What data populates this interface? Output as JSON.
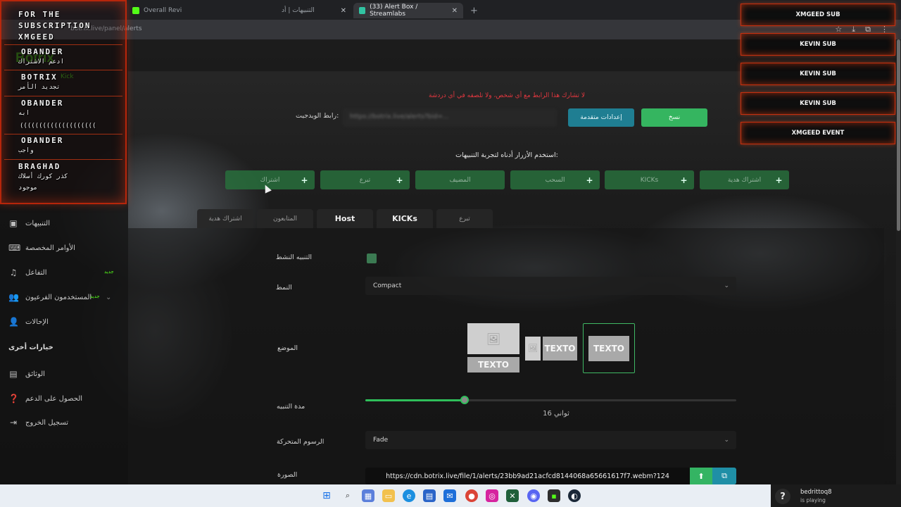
{
  "browser": {
    "tabs": [
      {
        "label": "Overall Revi",
        "active": false
      },
      {
        "label": "التنبيهات | أد",
        "active": false
      },
      {
        "label": "(33) Alert Box / Streamlabs",
        "active": true
      }
    ],
    "new_tab": "+",
    "url": "botrix.live/panel/alerts"
  },
  "sidebar": {
    "logo": "Botrix",
    "logo_sub": "Kick",
    "items": [
      {
        "label": "التنبيهات",
        "icon": "alert-icon"
      },
      {
        "label": "الأوامر المخصصة",
        "icon": "command-icon"
      },
      {
        "label": "التفاعل",
        "icon": "music-icon",
        "badge": "جديد"
      },
      {
        "label": "المستخدمون الفرعيون",
        "icon": "users-icon",
        "badge": "جديد"
      },
      {
        "label": "الإحالات",
        "icon": "referral-icon"
      }
    ],
    "other_heading": "خيارات أخرى",
    "other_items": [
      {
        "label": "الوثائق",
        "icon": "document-icon"
      },
      {
        "label": "الحصول على الدعم",
        "icon": "help-icon"
      },
      {
        "label": "تسجيل الخروج",
        "icon": "logout-icon"
      }
    ]
  },
  "overlay_left": {
    "lines": [
      "FOR THE",
      "SUBSCRIPTION",
      "XMGEED",
      "OBANDER",
      "ادعم الاشتراك",
      "BOTRIX",
      "تجديد الأمر",
      "OBANDER",
      "ابه",
      "((((((((((((((((((((",
      "OBANDER",
      "واجب",
      "BRAGHAD",
      "كذر كورك أسلاك",
      "موجود"
    ]
  },
  "overlay_right": {
    "items": [
      "XMGEED SUB",
      "KEVIN SUB",
      "KEVIN SUB",
      "KEVIN SUB",
      "XMGEED EVENT"
    ]
  },
  "main": {
    "warning": "لا تشارك هذا الرابط مع أي شخص، ولا تلصقه في أي دردشة",
    "widget_url_label": "رابط الويدجيت:",
    "widget_url": "https://botrix.live/alerts?bid=...",
    "advanced_button": "إعدادات متقدمة",
    "copy_button": "نسخ",
    "test_hint": "استخدم الأزرار أدناه لتجربة التنبيهات:",
    "test_buttons": [
      "اشتراك",
      "تبرع",
      "المضيف",
      "السحب",
      "KICKs",
      "اشتراك هدية"
    ],
    "alert_tabs": [
      "اشتراك هدية",
      "المتابعون",
      "Host",
      "KICKs",
      "تبرع"
    ],
    "fields": {
      "active_label": "التنبيه النشط",
      "style_label": "النمط",
      "style_value": "Compact",
      "position_label": "الموضع",
      "position_text": "TEXTO",
      "duration_label": "مدة التنبيه",
      "duration_value": 16,
      "duration_max": 60,
      "duration_text": "ثواني 16",
      "animation_label": "الرسوم المتحركة",
      "animation_value": "Fade",
      "image_label": "الصورة",
      "image_url": "https://cdn.botrix.live/file/1/alerts/23bb9ad21acfcd8144068a65661617f7.webm?124"
    }
  },
  "taskbar": {
    "steam_user": "bedrittoq8",
    "steam_status": "is playing"
  },
  "colors": {
    "accent_green": "#35b560",
    "accent_teal": "#1f7e92",
    "warning_red": "#e2373f",
    "overlay_border": "#d2320f"
  }
}
